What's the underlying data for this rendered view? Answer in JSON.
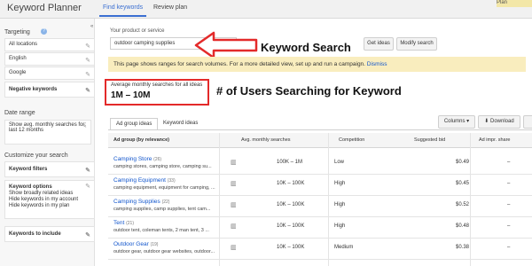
{
  "app": {
    "title": "Keyword Planner"
  },
  "tabs": [
    {
      "label": "Find keywords"
    },
    {
      "label": "Review plan"
    }
  ],
  "top_right_button": "Plan",
  "sidebar": {
    "targeting_label": "Targeting",
    "targeting_help_icon": "help-icon",
    "targeting_items": [
      "All locations",
      "English",
      "Google",
      "Negative keywords"
    ],
    "date_range_label": "Date range",
    "date_range_value": "Show avg. monthly searches for: last 12 months",
    "customize_label": "Customize your search",
    "keyword_filters": "Keyword filters",
    "keyword_options_title": "Keyword options",
    "keyword_options_lines": [
      "Show broadly related ideas",
      "Hide keywords in my account",
      "Hide keywords in my plan"
    ],
    "keywords_to_include": "Keywords to include"
  },
  "search": {
    "label": "Your product or service",
    "value": "outdoor camping supplies",
    "get_ideas": "Get ideas",
    "modify_search": "Modify search"
  },
  "notice": {
    "text": "This page shows ranges for search volumes. For a more detailed view, set up and run a campaign.",
    "dismiss": "Dismiss"
  },
  "avg": {
    "label": "Average monthly searches for all ideas",
    "value": "1M – 10M"
  },
  "annotations": {
    "keyword_search": "Keyword Search",
    "users_searching": "# of Users Searching for Keyword"
  },
  "subtabs": [
    "Ad group ideas",
    "Keyword ideas"
  ],
  "toolbar": {
    "columns": "Columns",
    "download": "Download"
  },
  "table": {
    "headers": [
      "Ad group (by relevance)",
      "Avg. monthly searches",
      "Competition",
      "Suggested bid",
      "Ad impr. share"
    ],
    "rows": [
      {
        "name": "Camping Store",
        "count": "(26)",
        "keywords": "camping stores, camping store, camping su...",
        "searches": "100K – 1M",
        "competition": "Low",
        "bid": "$0.49",
        "share": "–"
      },
      {
        "name": "Camping Equipment",
        "count": "(33)",
        "keywords": "camping equipment, equipment for camping, ...",
        "searches": "10K – 100K",
        "competition": "High",
        "bid": "$0.45",
        "share": "–"
      },
      {
        "name": "Camping Supplies",
        "count": "(22)",
        "keywords": "camping supplies, camp supplies, tent cam...",
        "searches": "10K – 100K",
        "competition": "High",
        "bid": "$0.52",
        "share": "–"
      },
      {
        "name": "Tent",
        "count": "(21)",
        "keywords": "outdoor tent, coleman tents, 2 man tent, 3 ...",
        "searches": "10K – 100K",
        "competition": "High",
        "bid": "$0.48",
        "share": "–"
      },
      {
        "name": "Outdoor Gear",
        "count": "(19)",
        "keywords": "outdoor gear, outdoor gear websites, outdoor...",
        "searches": "10K – 100K",
        "competition": "Medium",
        "bid": "$0.38",
        "share": "–"
      }
    ]
  },
  "colors": {
    "link": "#1155cc",
    "accent": "#3b6fd1",
    "annotation_red": "#e32a2a",
    "notice_bg": "#f9edbe"
  }
}
